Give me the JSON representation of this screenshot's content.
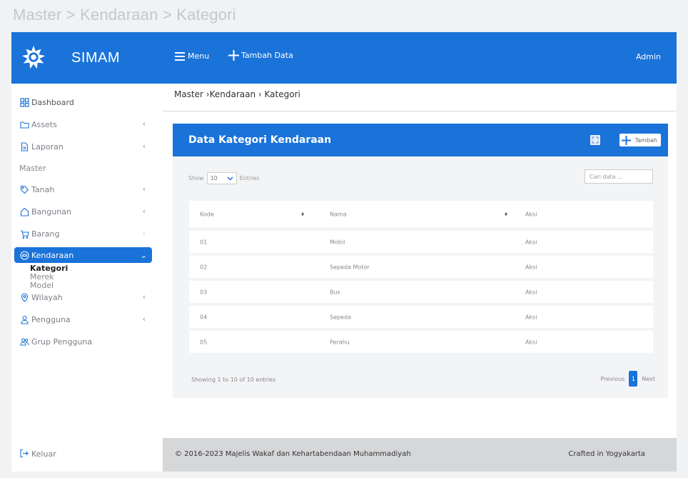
{
  "page_heading": "Master > Kendaraan > Kategori",
  "brand": {
    "name": "SIMAM"
  },
  "topbar": {
    "menu_label": "Menu",
    "add_label": "Tambah Data",
    "user": "Admin"
  },
  "sidebar": {
    "dashboard": "Dashboard",
    "assets": "Assets",
    "laporan": "Laporan",
    "section_master": "Master",
    "tanah": "Tanah",
    "bangunan": "Bangunan",
    "barang": "Barang",
    "kendaraan": "Kendaraan",
    "sub": [
      "Kategori",
      "Merek",
      "Model"
    ],
    "wilayah": "Wilayah",
    "pengguna": "Pengguna",
    "grup": "Grup Pengguna",
    "logout": "Keluar"
  },
  "breadcrumb": "Master ›Kendaraan › Kategori",
  "card": {
    "title": "Data Kategori Kendaraan",
    "add_label": "Tambah",
    "show_label": "Show",
    "show_value": "10",
    "entries_label": "Entries",
    "search_placeholder": "Cari data ..."
  },
  "table": {
    "headers": {
      "kode": "Kode",
      "nama": "Nama",
      "aksi": "Aksi"
    },
    "rows": [
      {
        "kode": "01",
        "nama": "Mobil",
        "aksi": "Aksi"
      },
      {
        "kode": "02",
        "nama": "Sepeda Motor",
        "aksi": "Aksi"
      },
      {
        "kode": "03",
        "nama": "Bus",
        "aksi": "Aksi"
      },
      {
        "kode": "04",
        "nama": "Sepeda",
        "aksi": "Aksi"
      },
      {
        "kode": "05",
        "nama": "Perahu",
        "aksi": "Aksi"
      }
    ]
  },
  "pagination": {
    "info": "Showing 1 to 10 of 10 entries",
    "prev": "Previous",
    "page": "1",
    "next": "Next"
  },
  "footer": {
    "copyright": "© 2016-2023 Majelis Wakaf dan Kehartabendaan Muhammadiyah",
    "crafted": "Crafted in Yogyakarta"
  },
  "colors": {
    "primary": "#1a73d9",
    "footer_bg": "#d6d7d9"
  },
  "icons": [
    "dashboard-icon",
    "folder-icon",
    "file-icon",
    "tag-icon",
    "home-icon",
    "cart-icon",
    "car-icon",
    "location-icon",
    "user-icon",
    "users-icon",
    "logout-icon",
    "hamburger-icon",
    "plus-icon",
    "expand-icon",
    "sort-icon",
    "chevron-left-icon",
    "chevron-down-icon"
  ]
}
